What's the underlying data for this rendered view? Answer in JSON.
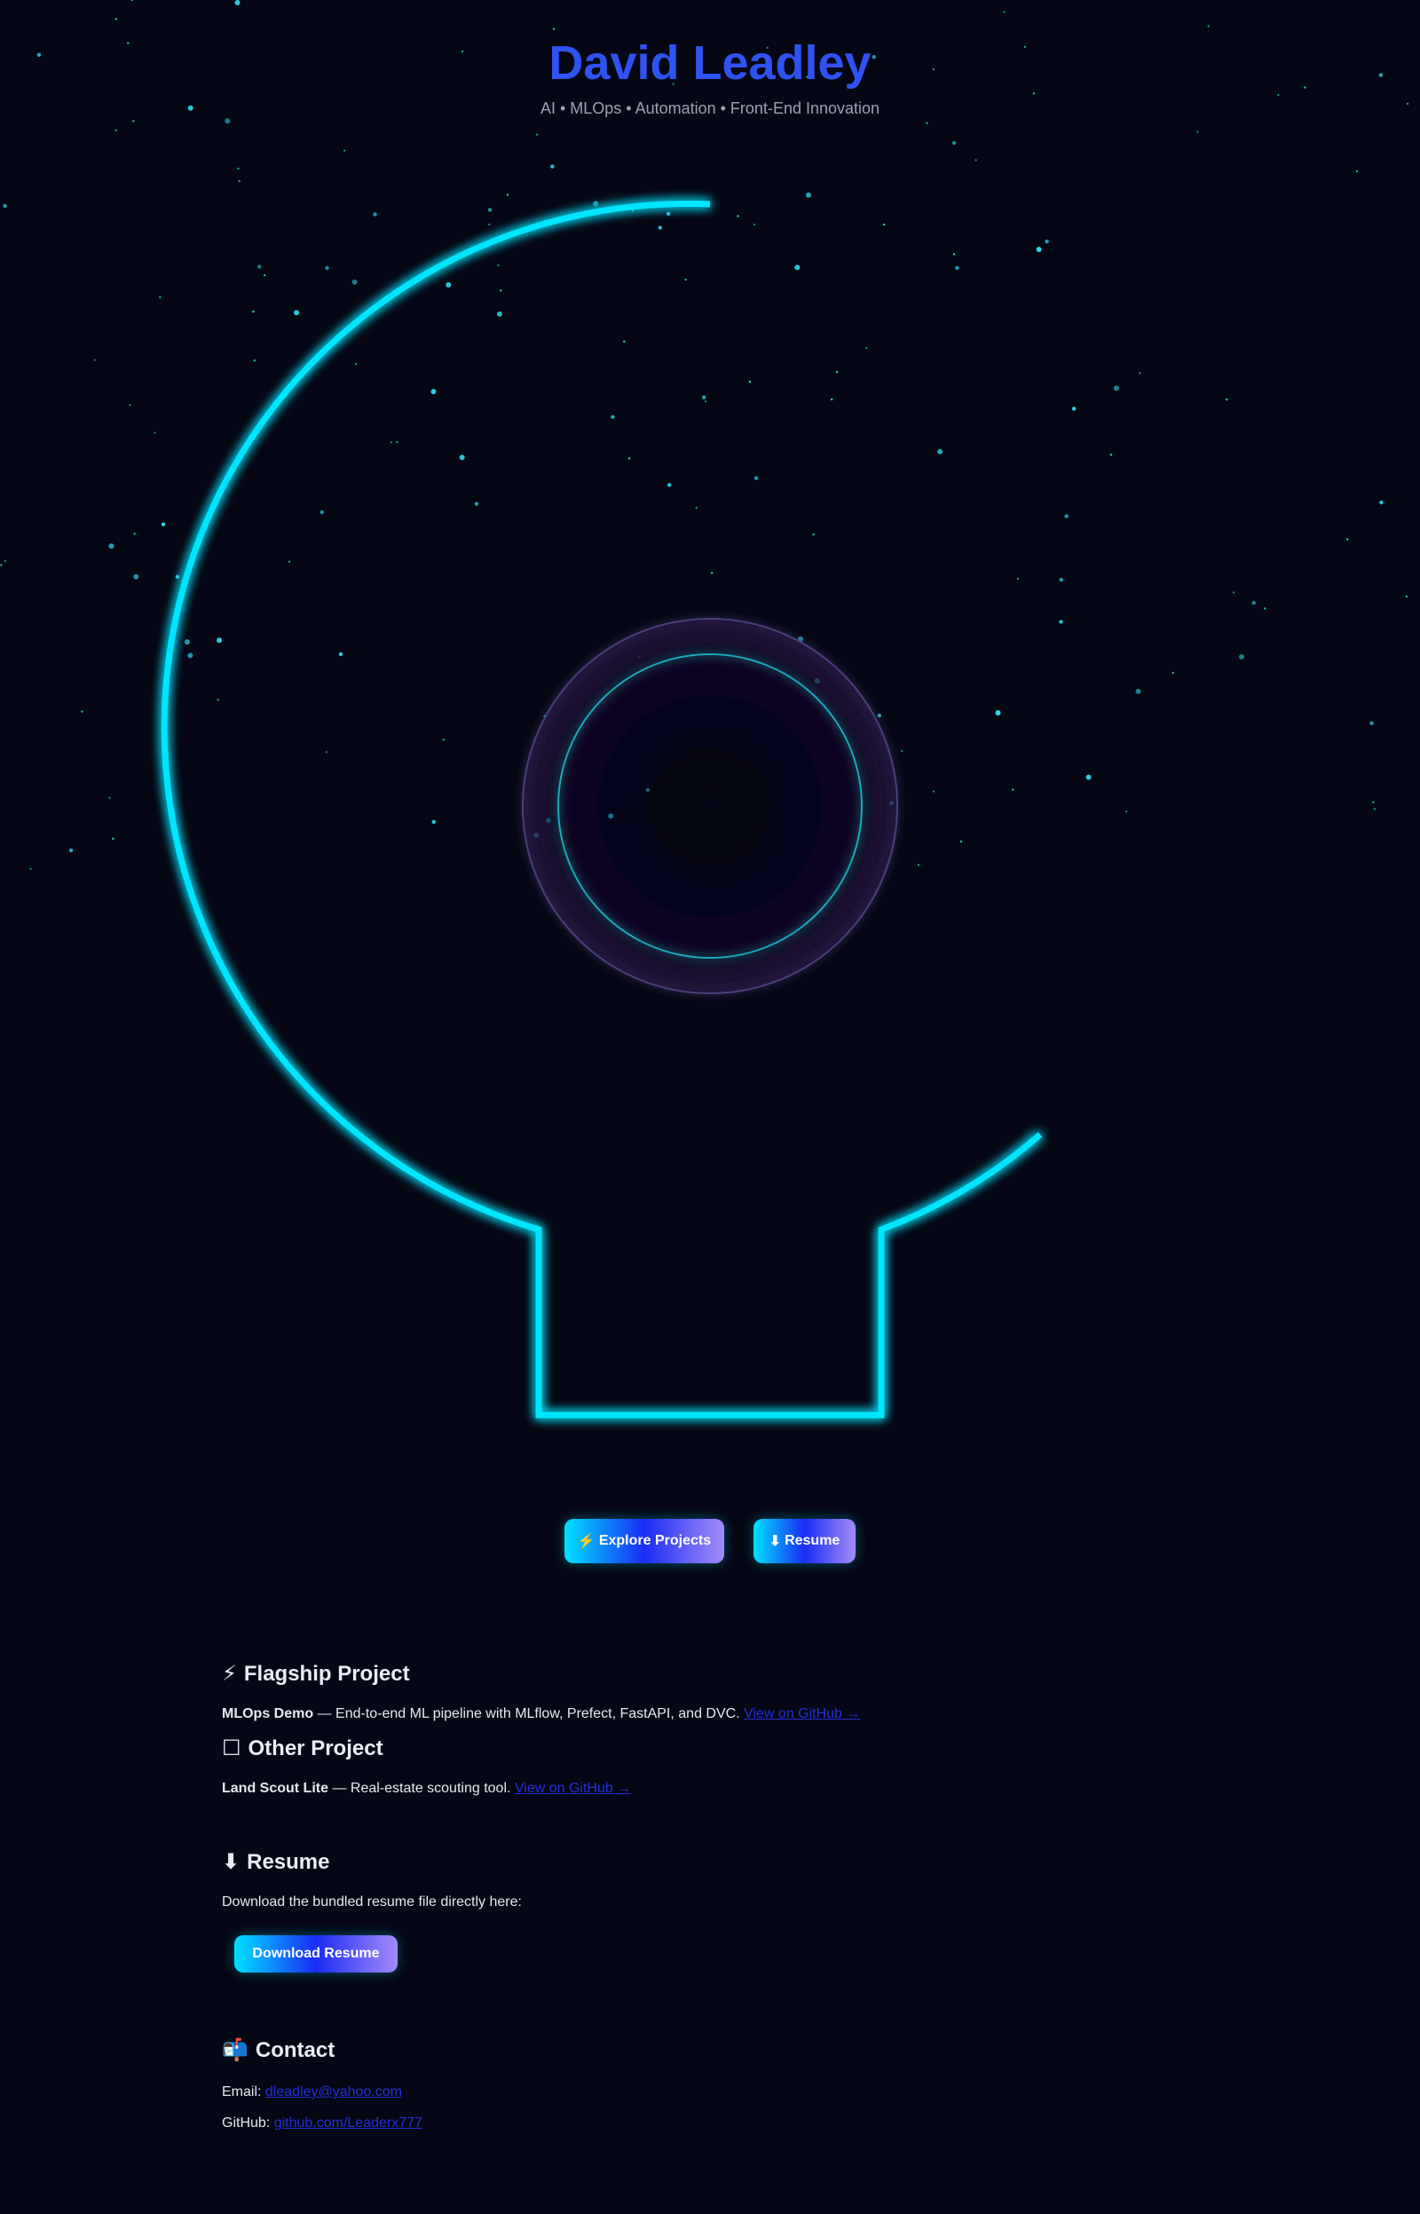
{
  "header": {
    "title": "David Leadley",
    "subtitle": "AI • MLOps • Automation • Front-End Innovation"
  },
  "colors": {
    "background": "#050714",
    "title": "#2f53f0",
    "neon": "#00e5ff",
    "link": "#2430d8",
    "button_gradient": [
      "#00e0ff",
      "#1b2cf5",
      "#a48cf7"
    ]
  },
  "cta": {
    "explore_icon": "⚡",
    "explore_label": "Explore Projects",
    "resume_icon": "⬇",
    "resume_label": "Resume"
  },
  "flagship": {
    "icon": "⚡",
    "heading": "Flagship Project",
    "project_name": "MLOps Demo",
    "description": " — End-to-end ML pipeline with MLflow, Prefect, FastAPI, and DVC. ",
    "link_label": "View on GitHub →"
  },
  "other": {
    "icon": "☐",
    "heading": "Other Project",
    "project_name": "Land Scout Lite",
    "description": " — Real-estate scouting tool. ",
    "link_label": "View on GitHub →"
  },
  "resume": {
    "icon": "⬇",
    "heading": "Resume",
    "text": "Download the bundled resume file directly here:",
    "button_label": "Download Resume"
  },
  "contact": {
    "icon": "📬",
    "heading": "Contact",
    "email_label": "Email: ",
    "email_value": "dleadley@yahoo.com",
    "github_label": "GitHub: ",
    "github_value": "github.com/Leaderx777"
  }
}
